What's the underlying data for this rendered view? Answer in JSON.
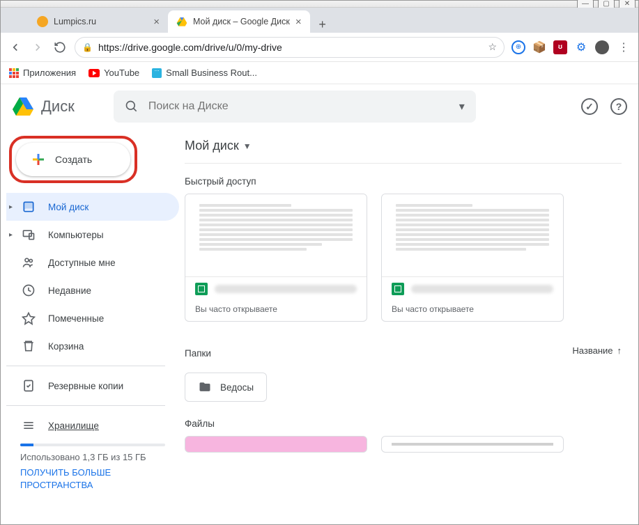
{
  "window": {
    "min": "—",
    "max": "▢",
    "close": "✕"
  },
  "tabs": [
    {
      "title": "Lumpics.ru",
      "favicon_color": "#f5a623"
    },
    {
      "title": "Мой диск – Google Диск",
      "favicon": "drive"
    }
  ],
  "url": "https://drive.google.com/drive/u/0/my-drive",
  "bookmarks": {
    "apps": "Приложения",
    "youtube": "YouTube",
    "sbr": "Small Business Rout..."
  },
  "drive": {
    "product": "Диск",
    "search_placeholder": "Поиск на Диске",
    "create": "Создать",
    "nav": {
      "mydrive": "Мой диск",
      "computers": "Компьютеры",
      "shared": "Доступные мне",
      "recent": "Недавние",
      "starred": "Помеченные",
      "trash": "Корзина",
      "backups": "Резервные копии",
      "storage": "Хранилище"
    },
    "storage_used": "Использовано 1,3 ГБ из 15 ГБ",
    "storage_link": "ПОЛУЧИТЬ БОЛЬШЕ ПРОСТРАНСТВА",
    "breadcrumb": "Мой диск",
    "quick_title": "Быстрый доступ",
    "quick_sub": "Вы часто открываете",
    "folders_title": "Папки",
    "sort_label": "Название",
    "folder1": "Ведосы",
    "files_title": "Файлы"
  }
}
